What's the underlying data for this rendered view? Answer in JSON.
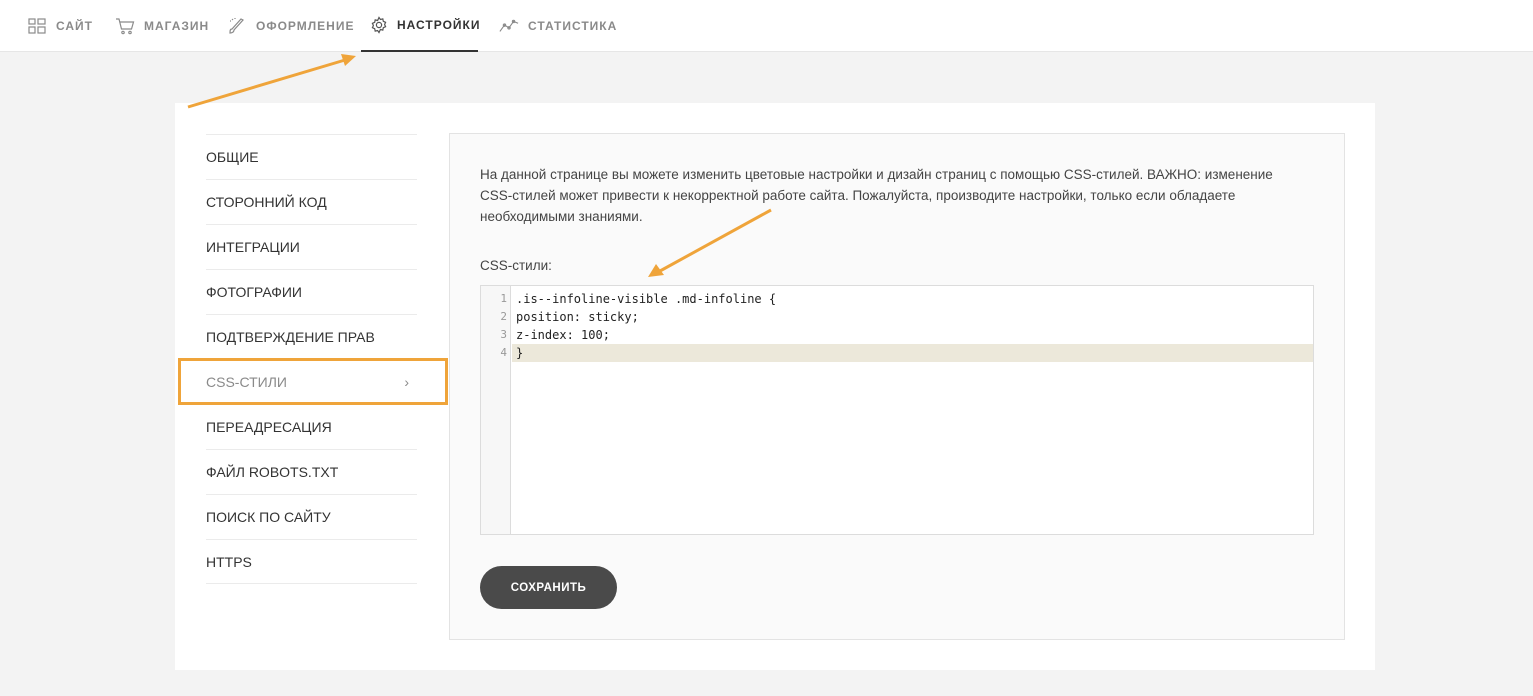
{
  "nav": {
    "items": [
      {
        "label": "САЙТ",
        "icon": "grid-icon"
      },
      {
        "label": "МАГАЗИН",
        "icon": "cart-icon"
      },
      {
        "label": "ОФОРМЛЕНИЕ",
        "icon": "brush-icon"
      },
      {
        "label": "НАСТРОЙКИ",
        "icon": "gear-icon"
      },
      {
        "label": "СТАТИСТИКА",
        "icon": "chart-line-icon"
      }
    ],
    "active": "НАСТРОЙКИ"
  },
  "sidebar": {
    "items": [
      {
        "label": "ОБЩИЕ"
      },
      {
        "label": "СТОРОННИЙ КОД"
      },
      {
        "label": "ИНТЕГРАЦИИ"
      },
      {
        "label": "ФОТОГРАФИИ"
      },
      {
        "label": "ПОДТВЕРЖДЕНИЕ ПРАВ"
      },
      {
        "label": "CSS-СТИЛИ",
        "chevron": "›"
      },
      {
        "label": "ПЕРЕАДРЕСАЦИЯ"
      },
      {
        "label": "ФАЙЛ ROBOTS.TXT"
      },
      {
        "label": "ПОИСК ПО САЙТУ"
      },
      {
        "label": "HTTPS"
      }
    ],
    "active": "CSS-СТИЛИ"
  },
  "panel": {
    "description": "На данной странице вы можете изменить цветовые настройки и дизайн страниц с помощью CSS-стилей. ВАЖНО: изменение CSS-стилей может привести к некорректной работе сайта. Пожалуйста, производите настройки, только если обладаете необходимыми знаниями.",
    "css_label": "CSS-стили:",
    "code_lines": [
      {
        "num": "1",
        "text": ".is--infoline-visible .md-infoline {"
      },
      {
        "num": "2",
        "text": "position: sticky;"
      },
      {
        "num": "3",
        "text": "z-index: 100;"
      },
      {
        "num": "4",
        "text": "}"
      }
    ],
    "save_label": "СОХРАНИТЬ"
  },
  "colors": {
    "accent": "#efa43a",
    "button": "#4a4a4a",
    "highlight_line": "#ece8da"
  }
}
